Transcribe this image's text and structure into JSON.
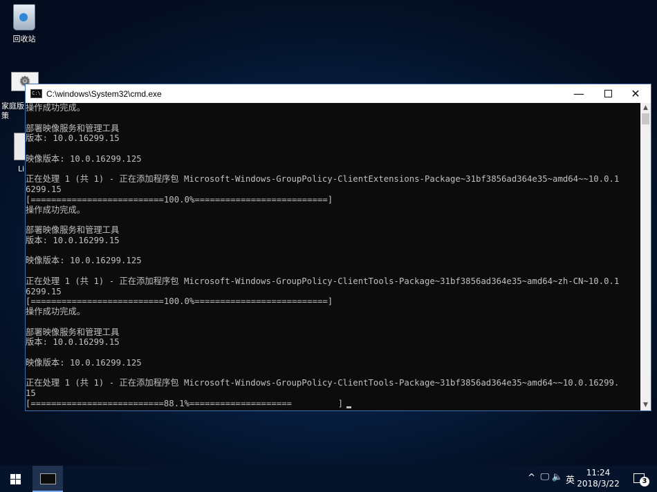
{
  "desktop": {
    "icons": [
      {
        "label": "回收站"
      },
      {
        "label": "家庭版\n策"
      },
      {
        "label": "Li"
      }
    ]
  },
  "window": {
    "title": "C:\\windows\\System32\\cmd.exe",
    "minimize": "—",
    "close": "✕"
  },
  "console": {
    "lines": [
      "操作成功完成。",
      "",
      "部署映像服务和管理工具",
      "版本: 10.0.16299.15",
      "",
      "映像版本: 10.0.16299.125",
      "",
      "正在处理 1 (共 1) - 正在添加程序包 Microsoft-Windows-GroupPolicy-ClientExtensions-Package~31bf3856ad364e35~amd64~~10.0.1",
      "6299.15",
      "[==========================100.0%==========================]",
      "操作成功完成。",
      "",
      "部署映像服务和管理工具",
      "版本: 10.0.16299.15",
      "",
      "映像版本: 10.0.16299.125",
      "",
      "正在处理 1 (共 1) - 正在添加程序包 Microsoft-Windows-GroupPolicy-ClientTools-Package~31bf3856ad364e35~amd64~zh-CN~10.0.1",
      "6299.15",
      "[==========================100.0%==========================]",
      "操作成功完成。",
      "",
      "部署映像服务和管理工具",
      "版本: 10.0.16299.15",
      "",
      "映像版本: 10.0.16299.125",
      "",
      "正在处理 1 (共 1) - 正在添加程序包 Microsoft-Windows-GroupPolicy-ClientTools-Package~31bf3856ad364e35~amd64~~10.0.16299.",
      "15"
    ],
    "progress_line": "[==========================88.1%====================         ]",
    "progress_percent": 88.1
  },
  "taskbar": {
    "tray_chevron": "^",
    "ime": "英",
    "time": "11:24",
    "date": "2018/3/22",
    "notification_count": "3"
  }
}
